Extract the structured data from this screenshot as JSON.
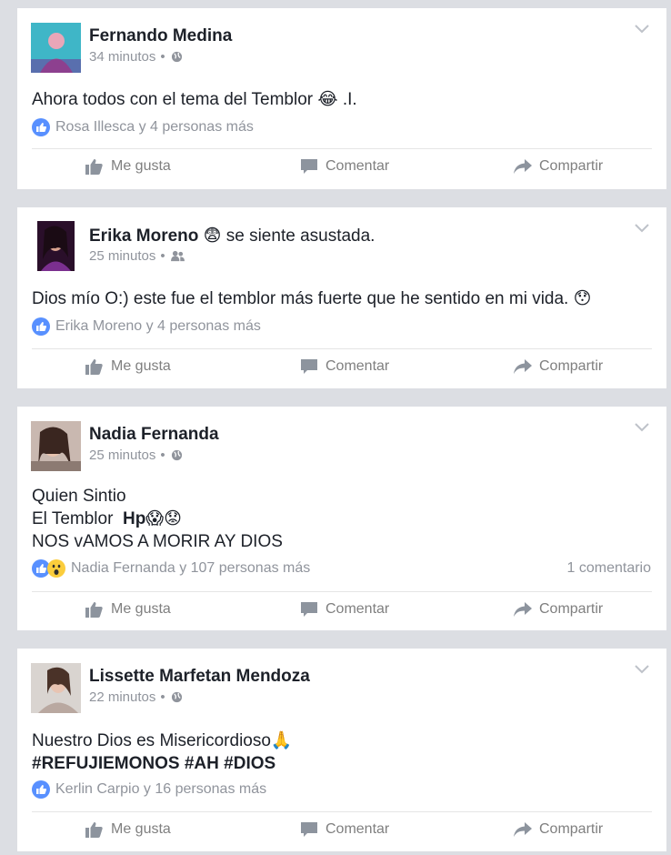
{
  "colors": {
    "background": "#dcdee3",
    "card": "#ffffff",
    "text": "#1d2129",
    "meta": "#90949c",
    "action": "#7f7f7f",
    "like_blue": "#5890ff",
    "divider": "#e5e5e5"
  },
  "actions": {
    "like": "Me gusta",
    "comment": "Comentar",
    "share": "Compartir"
  },
  "posts": [
    {
      "author": "Fernando Medina",
      "feeling": "",
      "time": "34 minutos",
      "privacy_icon": "globe-icon",
      "lines": [
        "Ahora todos con el tema del Temblor 😂 .I."
      ],
      "reaction_icons": [
        "like-icon"
      ],
      "reactions_text": "Rosa Illesca y 4 personas más",
      "comments": ""
    },
    {
      "author": "Erika Moreno",
      "feeling": "😨 se siente asustada.",
      "time": "25 minutos",
      "privacy_icon": "friends-icon",
      "lines": [
        "Dios mío O:) este fue el temblor más fuerte que he sentido en mi vida. 😯"
      ],
      "reaction_icons": [
        "like-icon"
      ],
      "reactions_text": "Erika Moreno y 4 personas más",
      "comments": ""
    },
    {
      "author": "Nadia Fernanda",
      "feeling": "",
      "time": "25 minutos",
      "privacy_icon": "globe-icon",
      "lines": [
        "Quien Sintio",
        "El Temblor",
        "Hp😱😟",
        "NOS vAMOS A MORIR AY DIOS"
      ],
      "reaction_icons": [
        "like-icon",
        "wow-icon"
      ],
      "reactions_text": "Nadia Fernanda y 107 personas más",
      "comments": "1 comentario"
    },
    {
      "author": "Lissette Marfetan Mendoza",
      "feeling": "",
      "time": "22 minutos",
      "privacy_icon": "globe-icon",
      "lines": [
        "Nuestro Dios es Misericordioso🙏",
        "#REFUJIEMONOS #AH #DIOS"
      ],
      "reaction_icons": [
        "like-icon"
      ],
      "reactions_text": "Kerlin Carpio y 16 personas más",
      "comments": ""
    }
  ]
}
